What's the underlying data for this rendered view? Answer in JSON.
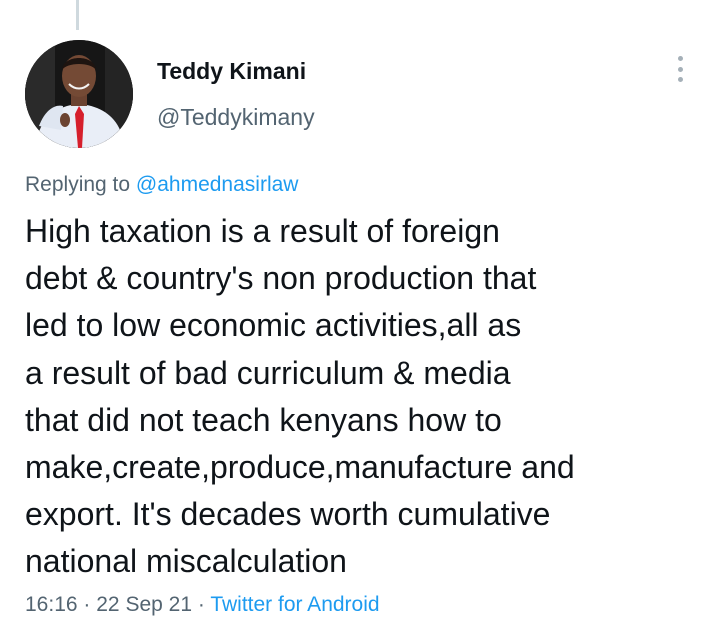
{
  "author": {
    "display_name": "Teddy Kimani",
    "handle": "@Teddykimany"
  },
  "reply": {
    "prefix": "Replying to",
    "mention": "@ahmednasirlaw"
  },
  "tweet": {
    "text": "High taxation is a result of foreign\ndebt & country's non production that\nled to low economic activities,all as\na result of bad curriculum & media\nthat did not teach kenyans how to\nmake,create,produce,manufacture and\nexport. It's decades worth cumulative\nnational miscalculation"
  },
  "meta": {
    "time": "16:16",
    "separator1": "·",
    "date": "22 Sep 21",
    "separator2": "·",
    "source": "Twitter for Android"
  },
  "icons": {
    "more": "more-vertical-icon"
  },
  "colors": {
    "link": "#1d9bf0",
    "secondary_text": "#536471",
    "primary_text": "#0f1419"
  }
}
